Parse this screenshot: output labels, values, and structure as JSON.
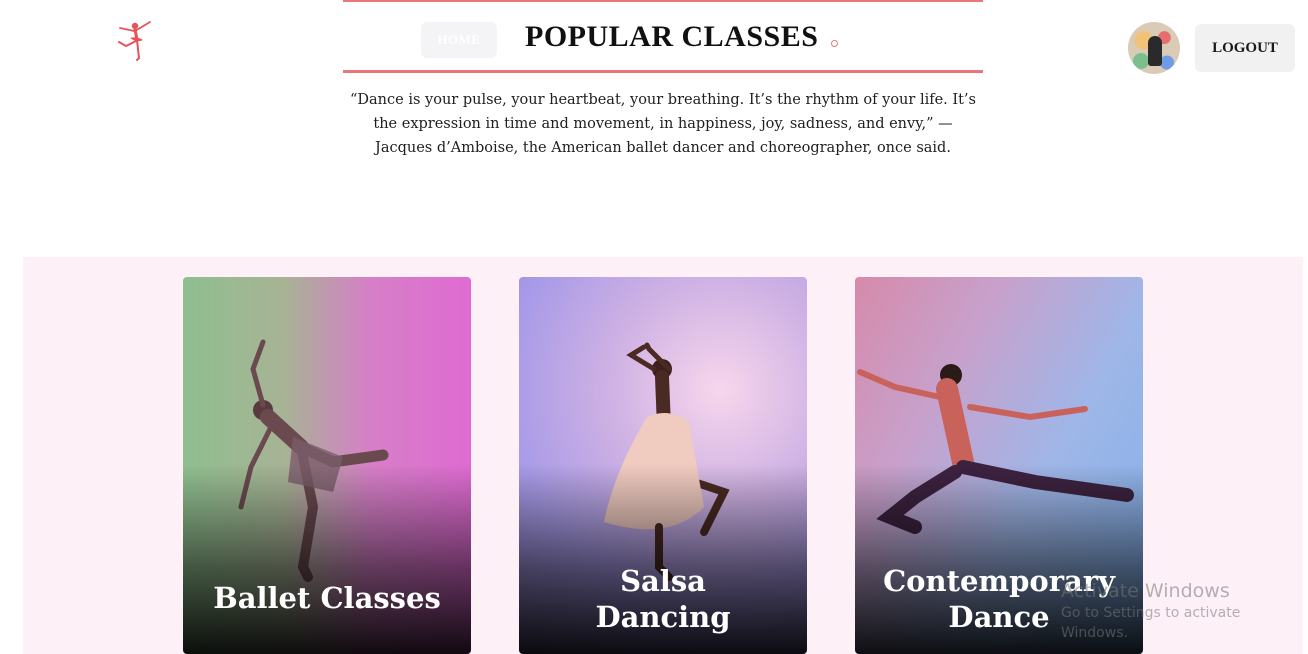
{
  "header": {
    "home_label": "HOME",
    "title": "POPULAR CLASSES",
    "logout_label": "LOGOUT"
  },
  "quote": "“Dance is your pulse, your heartbeat, your breathing. It’s the rhythm of your life. It’s the expression in time and movement, in happiness, joy, sadness, and envy,” — Jacques d’Amboise, the American ballet dancer and choreographer, once said.",
  "classes": [
    {
      "label_line1": "Ballet Classes",
      "label_line2": ""
    },
    {
      "label_line1": "Salsa",
      "label_line2": "Dancing"
    },
    {
      "label_line1": "Contemporary",
      "label_line2": "Dance"
    }
  ],
  "watermark": {
    "line1": "Activate Windows",
    "line2": "Go to Settings to activate Windows."
  },
  "colors": {
    "accent": "#e8777a",
    "section_bg": "#fdf0f6",
    "logo": "#e8535a"
  },
  "icons": {
    "logo": "ballerina-logo-icon",
    "avatar": "user-avatar"
  }
}
